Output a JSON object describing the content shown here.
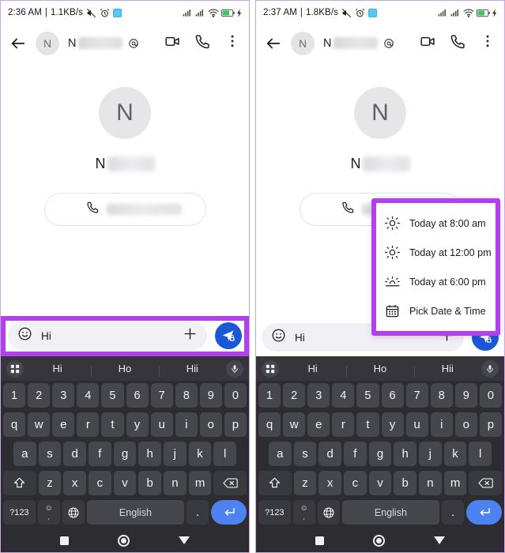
{
  "panels": [
    {
      "id": "left",
      "status": {
        "time": "2:36 AM",
        "separator": "|",
        "net_speed": "1.1KB/s",
        "icons": [
          "mute-icon",
          "alarm-icon",
          "screenshot-icon",
          "signal-1-icon",
          "signal-2-icon",
          "wifi-icon",
          "battery-icon",
          "charging-icon"
        ]
      },
      "appbar": {
        "back": "back-arrow-icon",
        "avatar_letter": "N",
        "name": "N",
        "badge": "at-sign-icon",
        "video_call": "video-call-icon",
        "voice_call": "phone-icon",
        "overflow": "more-vertical-icon"
      },
      "contact": {
        "avatar_letter": "N",
        "name_initial": "N"
      },
      "phone_action": {
        "icon": "phone-icon"
      },
      "composer": {
        "emoji_icon": "emoji-icon",
        "text": "Hi",
        "plus_icon": "plus-icon",
        "send_icon": "send-secure-icon",
        "highlighted": true
      },
      "schedule_menu": {
        "visible": false,
        "items": []
      }
    },
    {
      "id": "right",
      "status": {
        "time": "2:37 AM",
        "separator": "|",
        "net_speed": "1.8KB/s",
        "icons": [
          "mute-icon",
          "alarm-icon",
          "screenshot-icon",
          "signal-1-icon",
          "signal-2-icon",
          "wifi-icon",
          "battery-icon",
          "charging-icon"
        ]
      },
      "appbar": {
        "back": "back-arrow-icon",
        "avatar_letter": "N",
        "name": "N",
        "badge": "at-sign-icon",
        "video_call": "video-call-icon",
        "voice_call": "phone-icon",
        "overflow": "more-vertical-icon"
      },
      "contact": {
        "avatar_letter": "N",
        "name_initial": "N"
      },
      "phone_action": {
        "icon": "phone-icon"
      },
      "composer": {
        "emoji_icon": "emoji-icon",
        "text": "Hi",
        "plus_icon": "plus-icon",
        "send_icon": "send-secure-icon",
        "highlighted": false
      },
      "schedule_menu": {
        "visible": true,
        "items": [
          {
            "icon": "sun-icon",
            "label": "Today at 8:00 am"
          },
          {
            "icon": "sun-icon",
            "label": "Today at 12:00 pm"
          },
          {
            "icon": "sunset-icon",
            "label": "Today at 6:00 pm"
          },
          {
            "icon": "calendar-icon",
            "label": "Pick Date & Time"
          }
        ]
      }
    }
  ],
  "keyboard": {
    "suggestions": [
      "Hi",
      "Ho",
      "Hii"
    ],
    "grid_icon": "grid-icon",
    "mic_icon": "microphone-icon",
    "rows": {
      "numbers": [
        "1",
        "2",
        "3",
        "4",
        "5",
        "6",
        "7",
        "8",
        "9",
        "0"
      ],
      "top": [
        "q",
        "w",
        "e",
        "r",
        "t",
        "y",
        "u",
        "i",
        "o",
        "p"
      ],
      "home": [
        "a",
        "s",
        "d",
        "f",
        "g",
        "h",
        "j",
        "k",
        "l"
      ],
      "bottom": [
        "z",
        "x",
        "c",
        "v",
        "b",
        "n",
        "m"
      ]
    },
    "shift_icon": "shift-icon",
    "backspace_icon": "backspace-icon",
    "symbols_key": "?123",
    "emoji_comma_top": "☺",
    "emoji_comma_bottom": ",",
    "globe_icon": "globe-icon",
    "space_label": "English",
    "period_key": ".",
    "enter_icon": "enter-icon"
  },
  "navbar": {
    "recents": "square-icon",
    "home": "circle-icon",
    "back": "triangle-down-icon"
  },
  "colors": {
    "accent_purple": "#b33ff0",
    "send_blue": "#1a58d8",
    "enter_blue": "#4d82f3",
    "keyboard_bg": "#2c2c31",
    "key_bg": "#46464d"
  }
}
